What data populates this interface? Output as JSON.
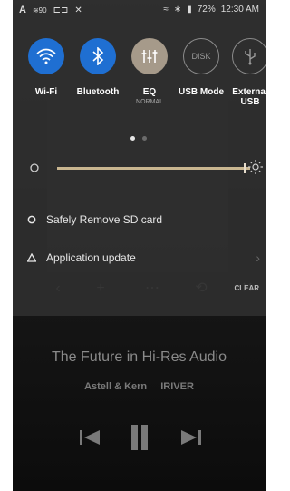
{
  "status_bar": {
    "left_icons": [
      "a-icon",
      "signal-90-icon",
      "cast-icon",
      "shuffle-icon"
    ],
    "signal_label": "90",
    "battery": "72%",
    "time": "12:30 AM"
  },
  "quick_settings": [
    {
      "label": "Wi-Fi",
      "state": "on",
      "icon": "wifi-icon"
    },
    {
      "label": "Bluetooth",
      "state": "on",
      "icon": "bluetooth-icon"
    },
    {
      "label": "EQ",
      "sub": "NORMAL",
      "state": "eq",
      "icon": "equalizer-icon"
    },
    {
      "label": "USB Mode",
      "state": "off",
      "icon": "disk-icon",
      "icon_text": "DISK"
    },
    {
      "label": "External USB",
      "state": "off",
      "icon": "usb-icon"
    }
  ],
  "page_indicator": {
    "pages": 2,
    "current": 1
  },
  "brightness": {
    "value": 0.97
  },
  "notifications": [
    {
      "text": "Safely Remove SD card",
      "icon": "sd-card-icon"
    },
    {
      "text": "Application update",
      "icon": "update-triangle-icon",
      "chevron": true
    }
  ],
  "clear_label": "CLEAR",
  "player": {
    "title": "The Future in Hi-Res Audio",
    "artist": "Astell & Kern",
    "album": "IRIVER"
  },
  "colors": {
    "accent_blue": "#1f6fd2",
    "eq_tile": "#a69a8a",
    "slider": "#c9b690"
  }
}
